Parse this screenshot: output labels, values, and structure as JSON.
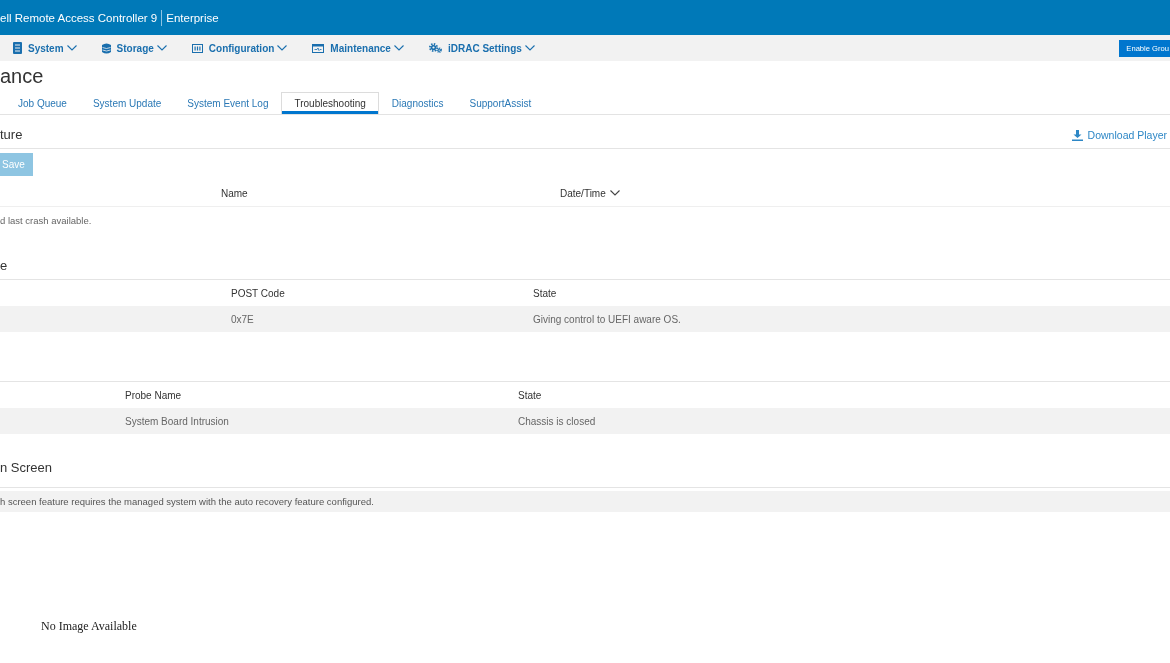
{
  "header": {
    "title": "ell Remote Access Controller 9",
    "edition": "Enterprise"
  },
  "nav": {
    "items": [
      {
        "label": "System"
      },
      {
        "label": "Storage"
      },
      {
        "label": "Configuration"
      },
      {
        "label": "Maintenance"
      },
      {
        "label": "iDRAC Settings"
      }
    ],
    "button": "Enable Grou"
  },
  "page_title": "ance",
  "tabs": [
    {
      "label": "Job Queue",
      "selected": false
    },
    {
      "label": "System Update",
      "selected": false
    },
    {
      "label": "System Event Log",
      "selected": false
    },
    {
      "label": "Troubleshooting",
      "selected": true
    },
    {
      "label": "Diagnostics",
      "selected": false
    },
    {
      "label": "SupportAssist",
      "selected": false
    }
  ],
  "sections": [
    {
      "kind": "capture",
      "heading": "ture",
      "link": "Download Player",
      "save_button": {
        "label": "Save",
        "disabled": true
      },
      "columns": [
        {
          "label": "Name",
          "sorted": false
        },
        {
          "label": "Date/Time",
          "sorted": true
        }
      ],
      "message": "d last crash available."
    },
    {
      "kind": "table",
      "heading": "e",
      "columns": [
        {
          "label": "POST Code"
        },
        {
          "label": "State"
        }
      ],
      "rows": [
        [
          "0x7E",
          "Giving control to UEFI aware OS."
        ]
      ]
    },
    {
      "kind": "table",
      "columns": [
        {
          "label": "Probe Name"
        },
        {
          "label": "State"
        }
      ],
      "rows": [
        [
          "System Board Intrusion",
          "Chassis is closed"
        ]
      ]
    },
    {
      "kind": "screen",
      "heading": "n Screen",
      "message": "h screen feature requires the managed system with the auto recovery feature configured.",
      "image_alt": "No Image Available"
    }
  ]
}
